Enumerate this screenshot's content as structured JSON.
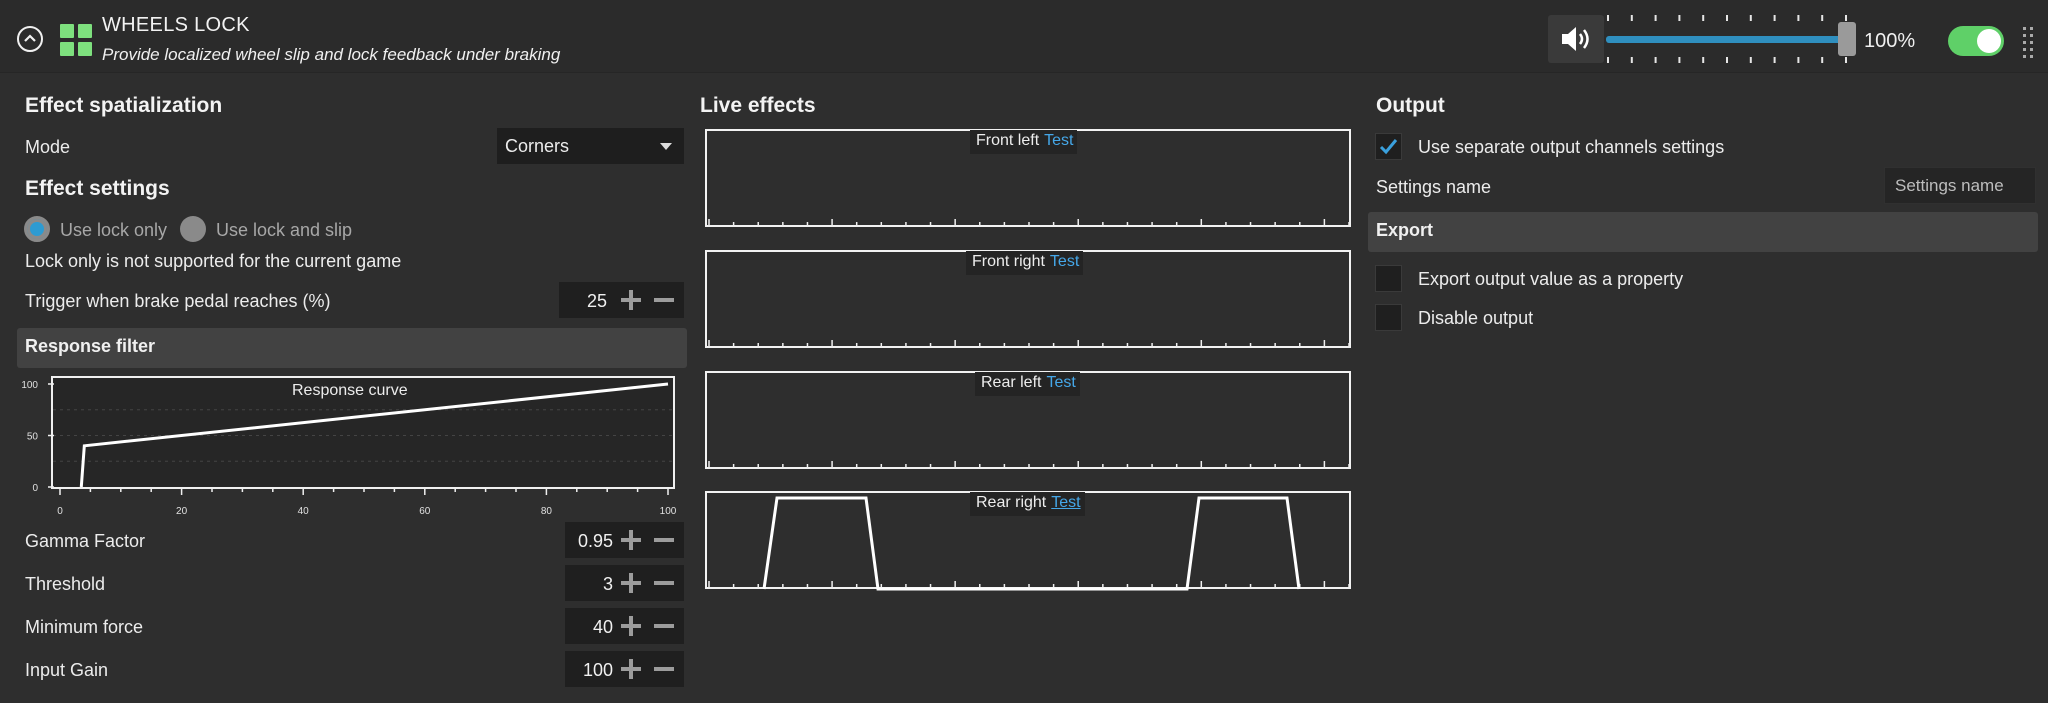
{
  "header": {
    "title": "WHEELS LOCK",
    "subtitle": "Provide localized wheel slip and lock feedback under braking",
    "volume": "100%",
    "volume_fraction": 1.0,
    "enabled": true
  },
  "left": {
    "spatialization_title": "Effect spatialization",
    "mode_label": "Mode",
    "mode_value": "Corners",
    "settings_title": "Effect settings",
    "radio_lock_only": "Use lock only",
    "radio_lock_slip": "Use lock and slip",
    "lock_note": "Lock only is not supported for the current game",
    "trigger_label": "Trigger when brake pedal reaches (%)",
    "trigger_value": "25",
    "response_filter": "Response filter",
    "curve_title": "Response curve",
    "curve": {
      "x_ticks": [
        "0",
        "20",
        "40",
        "60",
        "80",
        "100"
      ],
      "y_ticks": [
        "0",
        "50",
        "100"
      ],
      "points": [
        [
          3.5,
          0
        ],
        [
          4,
          40
        ],
        [
          100,
          100
        ]
      ]
    },
    "params": [
      {
        "label": "Gamma Factor",
        "value": "0.95"
      },
      {
        "label": "Threshold",
        "value": "3"
      },
      {
        "label": "Minimum force",
        "value": "40"
      },
      {
        "label": "Input Gain",
        "value": "100"
      }
    ]
  },
  "live": {
    "title": "Live effects",
    "test_label": "Test",
    "plots": [
      {
        "name": "Front left"
      },
      {
        "name": "Front right"
      },
      {
        "name": "Rear left"
      },
      {
        "name": "Rear right"
      }
    ]
  },
  "output": {
    "title": "Output",
    "separate_channels": "Use separate output channels settings",
    "separate_checked": true,
    "settings_name_label": "Settings name",
    "settings_name_placeholder": "Settings name",
    "export_title": "Export",
    "export_property": "Export output value as a property",
    "disable_output": "Disable output"
  },
  "colors": {
    "accent": "#2f8fbf",
    "toggle_on": "#5fd068",
    "link": "#45a7e8",
    "module_icon": "#7ee07e"
  }
}
